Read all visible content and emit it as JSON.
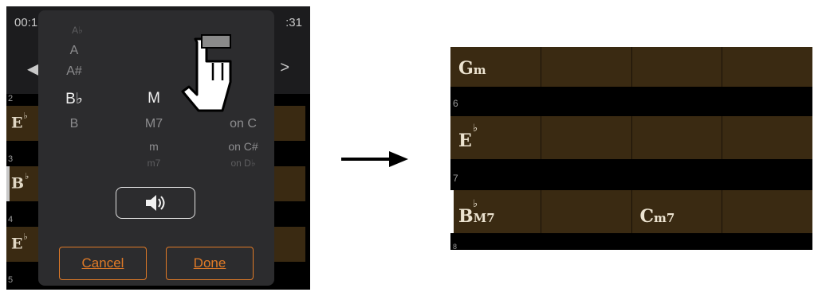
{
  "left_screen": {
    "time_left": "00:1",
    "time_right": ":31",
    "nav_prev_icon": "◀",
    "nav_next_icon": ">",
    "measure_numbers": [
      "2",
      "3",
      "4",
      "5"
    ],
    "row_chords": [
      {
        "root": "E",
        "accidental": "♭"
      },
      {
        "root": "B",
        "accidental": "♭"
      },
      {
        "root": "E",
        "accidental": "♭"
      }
    ],
    "picker": {
      "root_column": [
        "A♭",
        "A",
        "A#",
        "B♭",
        "B"
      ],
      "root_selected": "B♭",
      "quality_column": [
        "M",
        "M7",
        "m",
        "m7"
      ],
      "quality_selected": "M",
      "bass_column": [
        "on C",
        "on C#",
        "on D♭"
      ],
      "speaker_icon": "speaker-icon",
      "cancel_label": "Cancel",
      "done_label": "Done"
    }
  },
  "right_screen": {
    "rows": [
      {
        "number": "",
        "cells": [
          {
            "root": "G",
            "accidental": "",
            "quality": "m"
          },
          {},
          {},
          {}
        ]
      },
      {
        "number": "6",
        "cells": [
          {
            "root": "E",
            "accidental": "♭",
            "quality": ""
          },
          {},
          {},
          {}
        ]
      },
      {
        "number": "7",
        "cells": [
          {
            "root": "B",
            "accidental": "♭",
            "quality": "M7"
          },
          {},
          {
            "root": "C",
            "accidental": "",
            "quality": "m7"
          },
          {}
        ]
      },
      {
        "number": "8",
        "cells": []
      }
    ]
  },
  "colors": {
    "accent": "#e07a27",
    "cell_bg": "#3a2a12",
    "picker_bg": "#2c2c2e"
  }
}
